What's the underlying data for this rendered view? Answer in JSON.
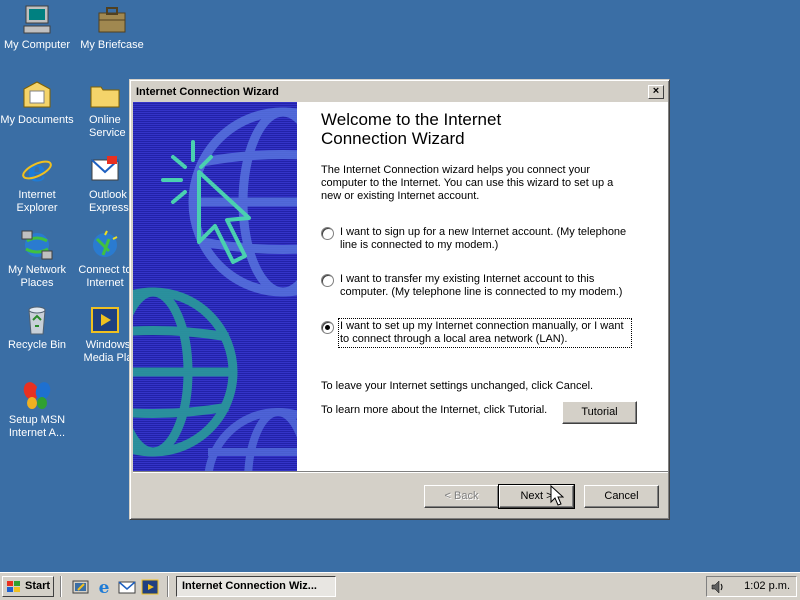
{
  "desktop": {
    "icons": [
      {
        "label": "My Computer",
        "icon": "computer-icon"
      },
      {
        "label": "My Briefcase",
        "icon": "briefcase-icon"
      },
      {
        "label": "My Documents",
        "icon": "documents-folder-icon"
      },
      {
        "label": "Online Service",
        "icon": "folder-icon"
      },
      {
        "label": "Internet Explorer",
        "icon": "internet-explorer-icon"
      },
      {
        "label": "Outlook Express",
        "icon": "outlook-express-icon"
      },
      {
        "label": "My Network Places",
        "icon": "network-places-icon"
      },
      {
        "label": "Connect to Internet",
        "icon": "connect-internet-icon"
      },
      {
        "label": "Recycle Bin",
        "icon": "recycle-bin-icon"
      },
      {
        "label": "Windows Media Pla",
        "icon": "media-player-icon"
      },
      {
        "label": "Setup MSN Internet A...",
        "icon": "msn-butterfly-icon"
      }
    ]
  },
  "wizard": {
    "title": "Internet Connection Wizard",
    "close_label": "×",
    "heading_line1": "Welcome to the Internet",
    "heading_line2": "Connection Wizard",
    "intro": "The Internet Connection wizard helps you connect your computer to the Internet.  You can use this wizard to set up a new or existing Internet account.",
    "options": [
      {
        "text": "I want to sign up for a new Internet account. (My telephone line is connected to my modem.)",
        "checked": false
      },
      {
        "text": "I want to transfer my existing Internet account to this computer. (My telephone line is connected to my modem.)",
        "checked": false
      },
      {
        "text": "I want to set up my Internet connection manually, or I want to connect through a local area network (LAN).",
        "checked": true
      }
    ],
    "leave_text": "To leave your Internet settings unchanged, click Cancel.",
    "learn_text": "To learn more about the Internet, click Tutorial.",
    "tutorial_label": "Tutorial",
    "back_label": "< Back",
    "next_label": "Next >",
    "cancel_label": "Cancel"
  },
  "taskbar": {
    "start_label": "Start",
    "task_label": "Internet Connection Wiz...",
    "clock": "1:02 p.m."
  },
  "colors": {
    "desktop": "#3a6ea5",
    "chrome": "#d4d0c8",
    "side_art": "#2a2ab0"
  }
}
